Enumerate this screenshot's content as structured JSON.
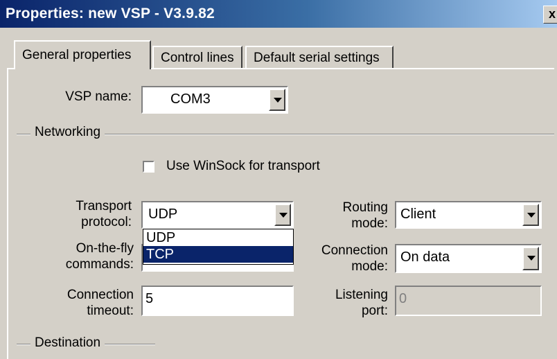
{
  "window": {
    "title": "Properties: new VSP - V3.9.82",
    "close_glyph": "x"
  },
  "tabs": [
    {
      "label": "General properties",
      "active": true
    },
    {
      "label": "Control lines",
      "active": false
    },
    {
      "label": "Default serial settings",
      "active": false
    }
  ],
  "vsp_name": {
    "label": "VSP name:",
    "value": "COM3"
  },
  "networking": {
    "group_label": "Networking",
    "winsock_checkbox": {
      "label": "Use WinSock for transport",
      "checked": false
    },
    "transport_protocol": {
      "label_line1": "Transport",
      "label_line2": "protocol:",
      "value": "UDP",
      "options": [
        {
          "label": "UDP",
          "selected": false
        },
        {
          "label": "TCP",
          "selected": true
        }
      ]
    },
    "onthefly": {
      "label_line1": "On-the-fly",
      "label_line2": "commands:"
    },
    "connection_timeout": {
      "label_line1": "Connection",
      "label_line2": "timeout:",
      "value": "5"
    },
    "routing_mode": {
      "label_line1": "Routing",
      "label_line2": "mode:",
      "value": "Client"
    },
    "connection_mode": {
      "label_line1": "Connection",
      "label_line2": "mode:",
      "value": "On data"
    },
    "listening_port": {
      "label_line1": "Listening",
      "label_line2": "port:",
      "value": "0"
    }
  },
  "destination": {
    "group_label": "Destination"
  },
  "colors": {
    "title_start": "#0a246a",
    "title_end": "#a6caf0",
    "selection": "#0a246a",
    "face": "#d4d0c8"
  }
}
